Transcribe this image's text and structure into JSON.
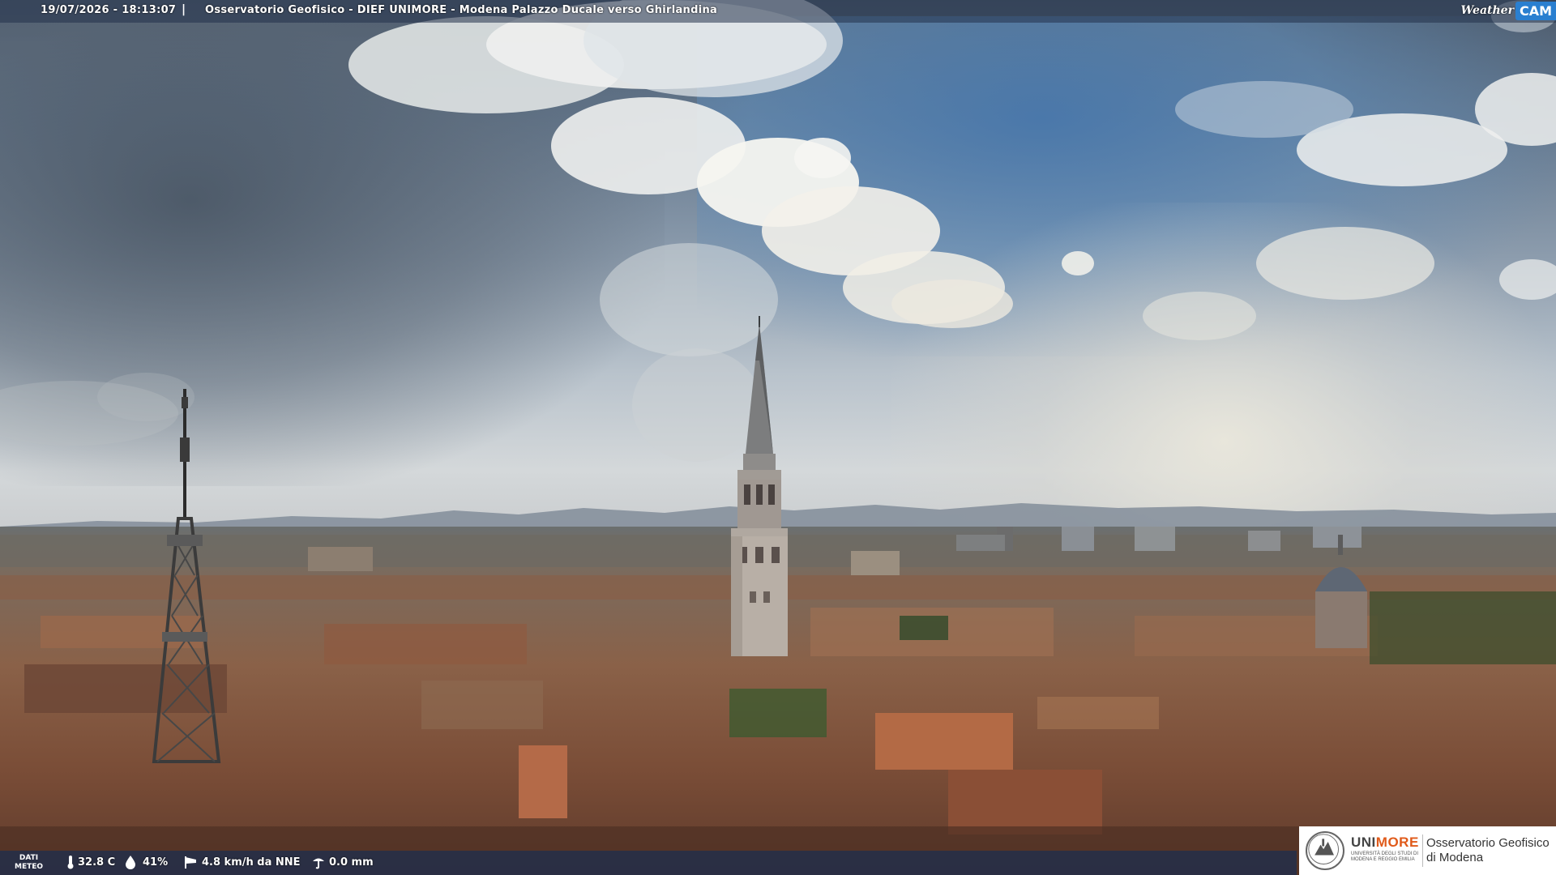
{
  "header": {
    "datetime": "19/07/2026 - 18:13:07",
    "separator": "|",
    "location": "Osservatorio Geofisico - DIEF UNIMORE - Modena Palazzo Ducale verso Ghirlandina"
  },
  "brand": {
    "weather": "Weather",
    "cam": "CAM",
    "accent_color": "#2a7fd0"
  },
  "meteo": {
    "label_line1": "DATI",
    "label_line2": "METEO",
    "temperature": "32.8 C",
    "humidity": "41%",
    "wind": "4.8 km/h da NNE",
    "rain": "0.0 mm",
    "icons": [
      "thermometer-icon",
      "humidity-drop-icon",
      "wind-sock-icon",
      "rain-gauge-icon"
    ]
  },
  "institution": {
    "name_part1": "UNI",
    "name_part2": "MORE",
    "subtitle": "UNIVERSITÀ DEGLI STUDI DI MODENA E REGGIO EMILIA",
    "observatory_line1": "Osservatorio Geofisico",
    "observatory_line2": "di Modena",
    "brand_color": "#e05a1a"
  }
}
